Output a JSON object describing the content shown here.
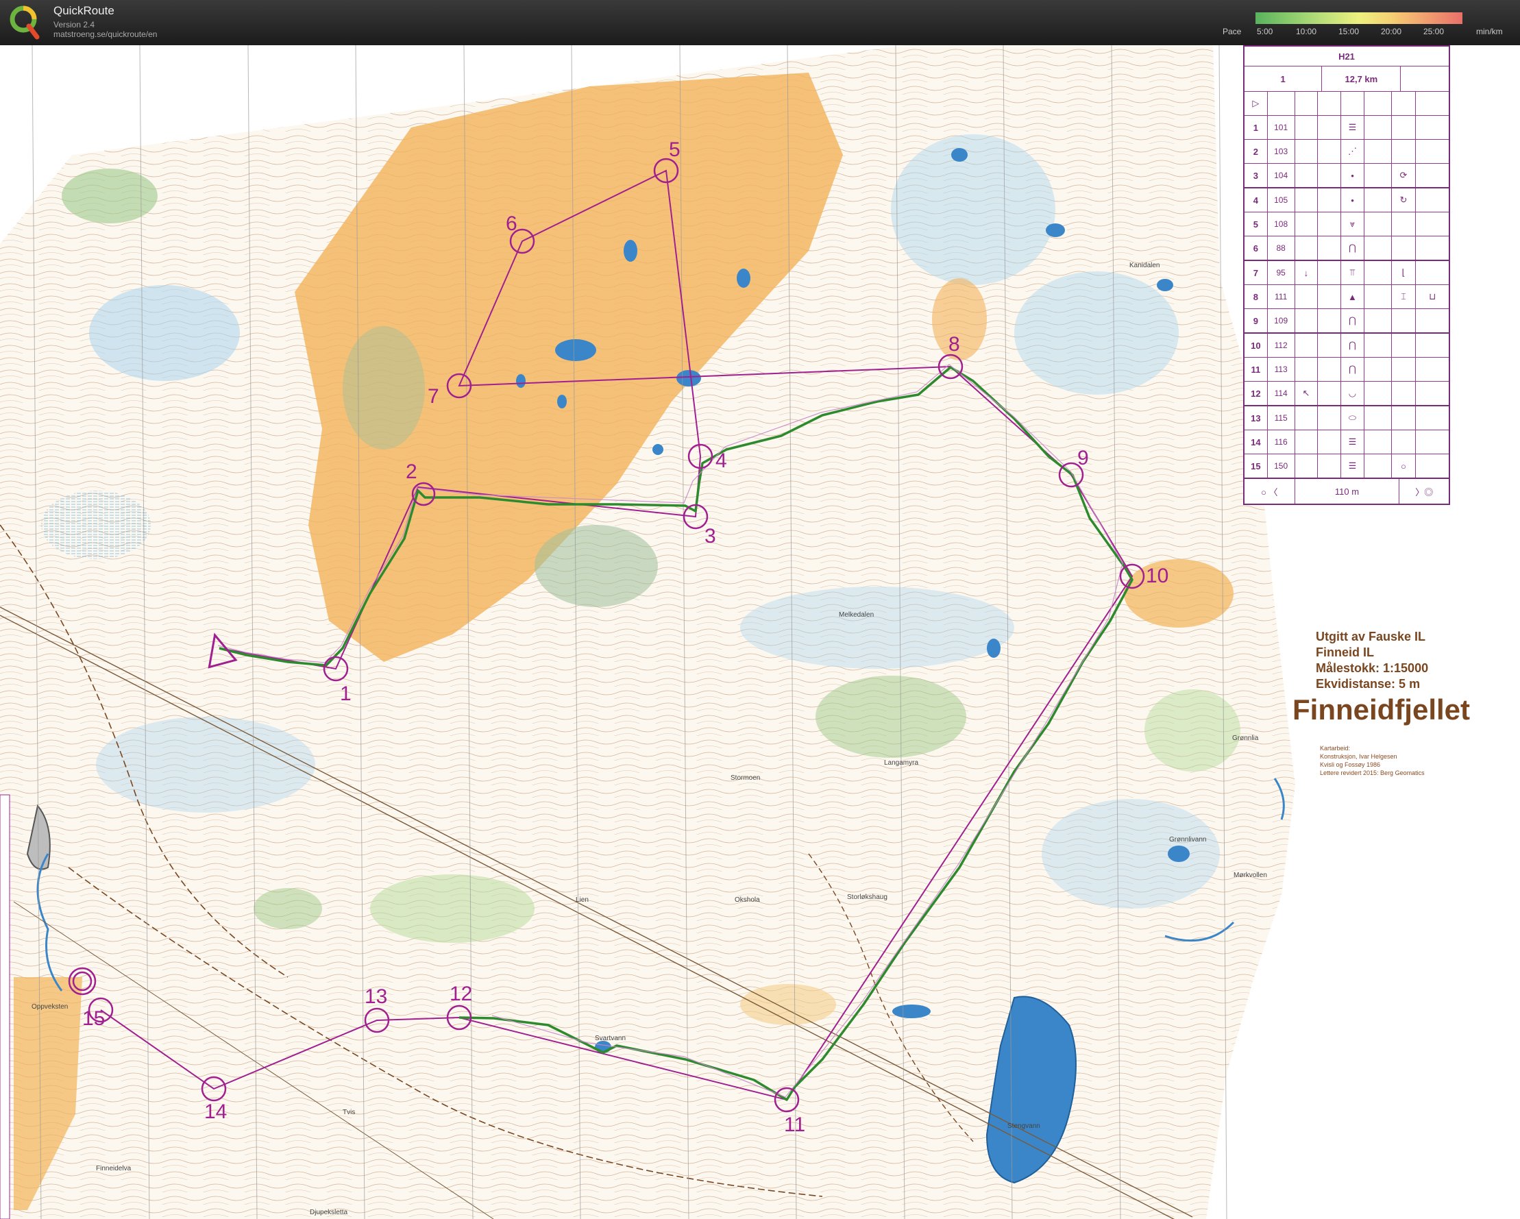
{
  "app": {
    "name": "QuickRoute",
    "version": "Version 2.4",
    "url": "matstroeng.se/quickroute/en"
  },
  "pace_legend": {
    "label": "Pace",
    "ticks": [
      "5:00",
      "10:00",
      "15:00",
      "20:00",
      "25:00"
    ],
    "unit": "min/km",
    "colors": {
      "fast": "#58b25e",
      "mid": "#eef07e",
      "slow": "#e8706a"
    }
  },
  "course": {
    "class": "H21",
    "number": "1",
    "length": "12,7 km",
    "final_leg": "110 m",
    "controls": [
      {
        "num": "1",
        "code": "101",
        "symbol": "☰"
      },
      {
        "num": "2",
        "code": "103",
        "symbol": "⋰"
      },
      {
        "num": "3",
        "code": "104",
        "symbol": "•",
        "extra": "⟳"
      },
      {
        "num": "4",
        "code": "105",
        "symbol": "•",
        "extra": "↻"
      },
      {
        "num": "5",
        "code": "108",
        "symbol": "⩔"
      },
      {
        "num": "6",
        "code": "88",
        "symbol": "⋂"
      },
      {
        "num": "7",
        "code": "95",
        "dir": "↓",
        "symbol": "⫪",
        "extra": "⌊"
      },
      {
        "num": "8",
        "code": "111",
        "symbol": "▲",
        "extra": "⌶",
        "extra2": "⊔"
      },
      {
        "num": "9",
        "code": "109",
        "symbol": "⋂"
      },
      {
        "num": "10",
        "code": "112",
        "symbol": "⋂"
      },
      {
        "num": "11",
        "code": "113",
        "symbol": "⋂"
      },
      {
        "num": "12",
        "code": "114",
        "dir": "↖",
        "symbol": "◡"
      },
      {
        "num": "13",
        "code": "115",
        "symbol": "⬭"
      },
      {
        "num": "14",
        "code": "116",
        "symbol": "☰"
      },
      {
        "num": "15",
        "code": "150",
        "symbol": "☰",
        "extra": "○"
      }
    ]
  },
  "map_info": {
    "publisher_line1": "Utgitt av Fauske IL",
    "publisher_line2": "Finneid IL",
    "scale": "Målestokk: 1:15000",
    "contour": "Ekvidistanse: 5 m",
    "title": "Finneidfjellet",
    "credits": [
      "Kartarbeid:",
      "Konstruksjon, Ivar Helgesen",
      "Kvisli og Fossøy 1986",
      "Lettere revidert 2015: Berg Geomatics"
    ]
  },
  "place_names": [
    "Kanidalen",
    "Melkedalen",
    "Grønnlia",
    "Langamyra",
    "Stormoen",
    "Grønnlivann",
    "Mørkvollen",
    "Okshola",
    "Storløkshaug",
    "Svartvann",
    "Stengvann",
    "Oppveksten",
    "Finneidelva",
    "Djupeksletta",
    "Lien",
    "Tvis"
  ],
  "map_colors": {
    "open_land": "#f2b35a",
    "water": "#3b86c8",
    "marsh": "#8fc6e6",
    "contour": "#9a5a2a",
    "vegetation": "#9fca8a",
    "course": "#a02090",
    "route": "#2a7a2a"
  },
  "controls_on_map": [
    "1",
    "2",
    "3",
    "4",
    "5",
    "6",
    "7",
    "8",
    "9",
    "10",
    "11",
    "12",
    "13",
    "14",
    "15"
  ]
}
